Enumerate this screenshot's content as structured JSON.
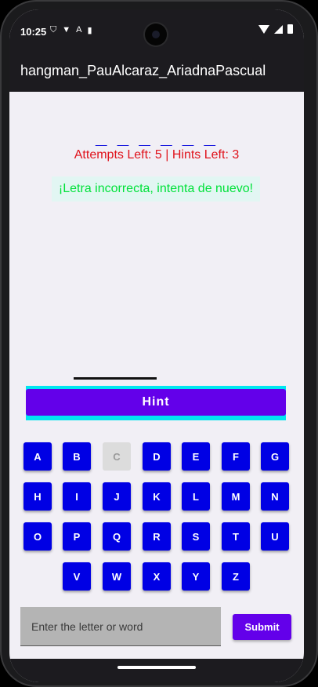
{
  "status_bar": {
    "time": "10:25",
    "left_icons": [
      "shield-icon",
      "play-protect-icon",
      "font-icon",
      "sd-card-icon"
    ],
    "right_icons": [
      "wifi-icon",
      "signal-icon",
      "battery-icon"
    ]
  },
  "app_bar": {
    "title": "hangman_PauAlcaraz_AriadnaPascual"
  },
  "game": {
    "word_display": "_ _ _ _ _ _",
    "attempts_hints": "Attempts Left: 5 | Hints Left: 3",
    "message": "¡Letra incorrecta, intenta de nuevo!",
    "hint_label": "Hint"
  },
  "keyboard": {
    "rows": [
      [
        "A",
        "B",
        "C",
        "D",
        "E",
        "F",
        "G"
      ],
      [
        "H",
        "I",
        "J",
        "K",
        "L",
        "M",
        "N"
      ],
      [
        "O",
        "P",
        "Q",
        "R",
        "S",
        "T",
        "U"
      ],
      [
        "V",
        "W",
        "X",
        "Y",
        "Z"
      ]
    ],
    "disabled": [
      "C"
    ]
  },
  "input": {
    "placeholder": "Enter the letter or word",
    "value": ""
  },
  "submit_label": "Submit",
  "colors": {
    "accent": "#6300ea",
    "key": "#0000e4",
    "hint_border": "#00e6f0",
    "error_text": "#e0121b",
    "message_text": "#00e23a"
  }
}
